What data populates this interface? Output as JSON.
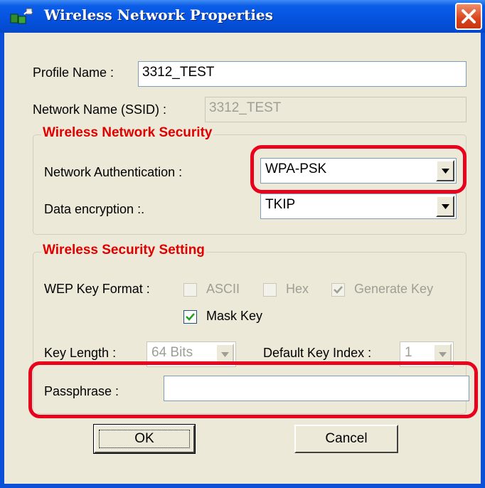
{
  "window": {
    "title": "Wireless Network Properties"
  },
  "profile_name": {
    "label": "Profile Name :",
    "value": "3312_TEST"
  },
  "network_name": {
    "label": "Network Name (SSID) :",
    "value": "3312_TEST"
  },
  "security_group": {
    "title": "Wireless Network Security",
    "authentication": {
      "label": "Network Authentication :",
      "value": "WPA-PSK"
    },
    "encryption": {
      "label": "Data encryption :.",
      "value": "TKIP"
    }
  },
  "setting_group": {
    "title": "Wireless Security Setting",
    "wep_key_format": {
      "label": "WEP Key Format :",
      "ascii": "ASCII",
      "hex": "Hex",
      "generate_key": "Generate Key"
    },
    "mask_key": "Mask Key",
    "key_length": {
      "label": "Key Length :",
      "value": "64 Bits"
    },
    "default_key_index": {
      "label": "Default Key Index :",
      "value": "1"
    },
    "passphrase": {
      "label": "Passphrase :",
      "value": ""
    }
  },
  "buttons": {
    "ok": "OK",
    "cancel": "Cancel"
  },
  "colors": {
    "title_bar": "#0653e0",
    "group_title": "#e00000",
    "highlight": "#e8001c",
    "dialog_bg": "#ece9d8"
  }
}
